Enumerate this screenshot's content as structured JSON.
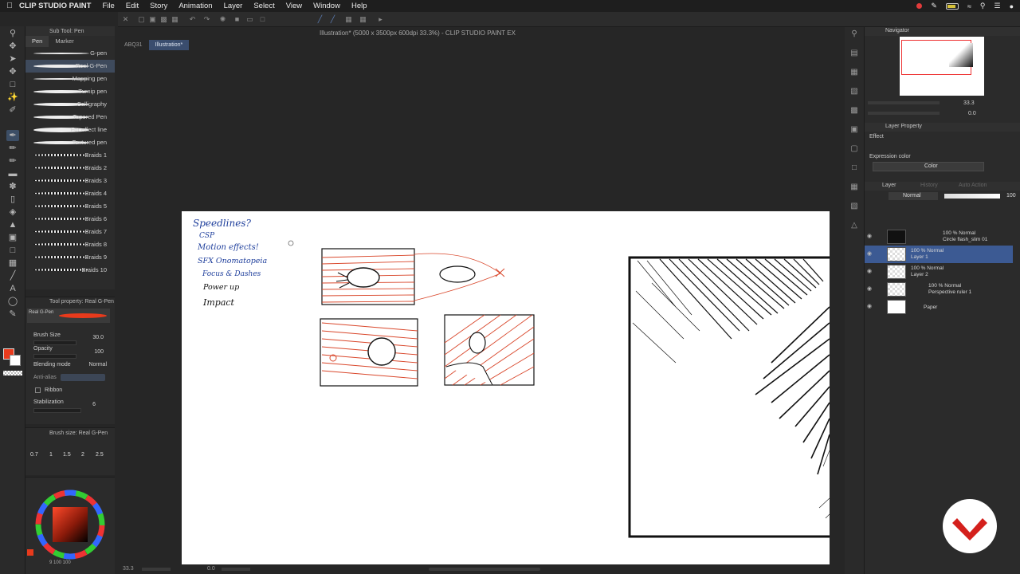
{
  "menubar": {
    "app": "CLIP STUDIO PAINT",
    "items": [
      "File",
      "Edit",
      "Story",
      "Animation",
      "Layer",
      "Select",
      "View",
      "Window",
      "Help"
    ]
  },
  "window": {
    "title": "Illustration* (5000 x 3500px 600dpi 33.3%) - CLIP STUDIO PAINT EX",
    "tabs": [
      "ABQ31",
      "Illustration*"
    ]
  },
  "subtool": {
    "title": "Sub Tool: Pen",
    "tabs": [
      "Pen",
      "Marker"
    ],
    "brushes": [
      "G-pen",
      "Real G-Pen",
      "Mapping pen",
      "Turnip pen",
      "Calligraphy",
      "Tapered Pen",
      "For effect line",
      "Textured pen",
      "Braids 1",
      "Braids 2",
      "Braids 3",
      "Braids 4",
      "Braids 5",
      "Braids 6",
      "Braids 7",
      "Braids 8",
      "Braids 9",
      "Braids 10"
    ],
    "selected": "Real G-Pen"
  },
  "toolprop": {
    "title": "Tool property: Real G-Pen",
    "preview_label": "Real G-Pen",
    "brush_size_label": "Brush Size",
    "brush_size_value": "30.0",
    "opacity_label": "Opacity",
    "opacity_value": "100",
    "blending_label": "Blending mode",
    "blending_value": "Normal",
    "antialias_label": "Anti-alias",
    "ribbon_label": "Ribbon",
    "stabilization_label": "Stabilization",
    "stabilization_value": "6"
  },
  "brushsize": {
    "title": "Brush size: Real G-Pen",
    "sizes": [
      "0.7",
      "1",
      "1.5",
      "2",
      "2.5"
    ]
  },
  "colors": {
    "main": "#e83a1c",
    "accent_select": "#3c5a93",
    "panel_bg": "#2b2b2b",
    "ink_blue": "#1f3f9c",
    "ink_red": "#d9472b"
  },
  "canvas_notes": {
    "title": "Speedlines?",
    "lines": [
      "CSP",
      "Motion effects!",
      "SFX Onomatopeia",
      "Focus & Dashes",
      "Power up",
      "Impact"
    ]
  },
  "navigator": {
    "title": "Navigator",
    "zoom": "33.3",
    "angle": "0.0"
  },
  "layer_property": {
    "title": "Layer Property",
    "effect_label": "Effect",
    "expression_label": "Expression color",
    "expression_value": "Color"
  },
  "layers_panel": {
    "tabs": [
      "Layer",
      "History",
      "Auto Action"
    ],
    "blend": "Normal",
    "opacity": "100",
    "layers": [
      {
        "line1": "100 % Normal",
        "line2": "Circle flash_slim 01"
      },
      {
        "line1": "100 % Normal",
        "line2": "Layer 1"
      },
      {
        "line1": "100 % Normal",
        "line2": "Layer 2"
      },
      {
        "line1": "100 % Normal",
        "line2": "Perspective ruler 1"
      },
      {
        "line1": "",
        "line2": "Paper"
      }
    ]
  },
  "statusbar": {
    "zoom": "33.3",
    "angle": "0.0"
  },
  "colorwheel_values": "9 100 100"
}
